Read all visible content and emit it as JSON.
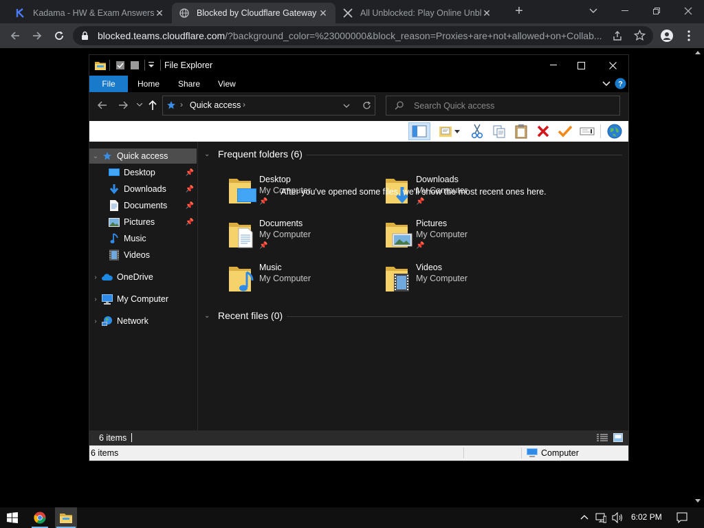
{
  "browser": {
    "tabs": [
      {
        "title": "Kadama - HW & Exam Answers, I",
        "icon": "kadama-k-icon",
        "active": false
      },
      {
        "title": "Blocked by Cloudflare Gateway",
        "icon": "globe-icon",
        "active": true
      },
      {
        "title": "All Unblocked: Play Online Unblo",
        "icon": "crossed-swords-icon",
        "active": false
      }
    ],
    "url_domain": "blocked.teams.cloudflare.com",
    "url_rest": "/?background_color=%23000000&block_reason=Proxies+are+not+allowed+on+Collab..."
  },
  "explorer": {
    "title": "File Explorer",
    "ribbon_tabs": [
      "File",
      "Home",
      "Share",
      "View"
    ],
    "breadcrumb": "Quick access",
    "search_placeholder": "Search Quick access",
    "nav": {
      "quick_access": "Quick access",
      "pinned": [
        "Desktop",
        "Downloads",
        "Documents",
        "Pictures"
      ],
      "others": [
        "Music",
        "Videos"
      ],
      "roots": [
        "OneDrive",
        "My Computer",
        "Network"
      ]
    },
    "frequent_header": "Frequent folders (6)",
    "folders": [
      {
        "name": "Desktop",
        "location": "My Computer",
        "pinned": true
      },
      {
        "name": "Downloads",
        "location": "My Computer",
        "pinned": true
      },
      {
        "name": "Documents",
        "location": "My Computer",
        "pinned": true
      },
      {
        "name": "Pictures",
        "location": "My Computer",
        "pinned": true
      },
      {
        "name": "Music",
        "location": "My Computer",
        "pinned": false
      },
      {
        "name": "Videos",
        "location": "My Computer",
        "pinned": false
      }
    ],
    "recent_header": "Recent files (0)",
    "recent_empty": "After you've opened some files, we'll show the most recent ones here.",
    "status_items": "6 items",
    "status_items_bottom": "6 items",
    "status_location": "Computer"
  },
  "taskbar": {
    "time": "6:02 PM"
  },
  "colors": {
    "accent": "#1979ca",
    "folder_yellow": "#f6d36a",
    "folder_dark": "#dcae3f",
    "selection": "#4d4d4d"
  }
}
